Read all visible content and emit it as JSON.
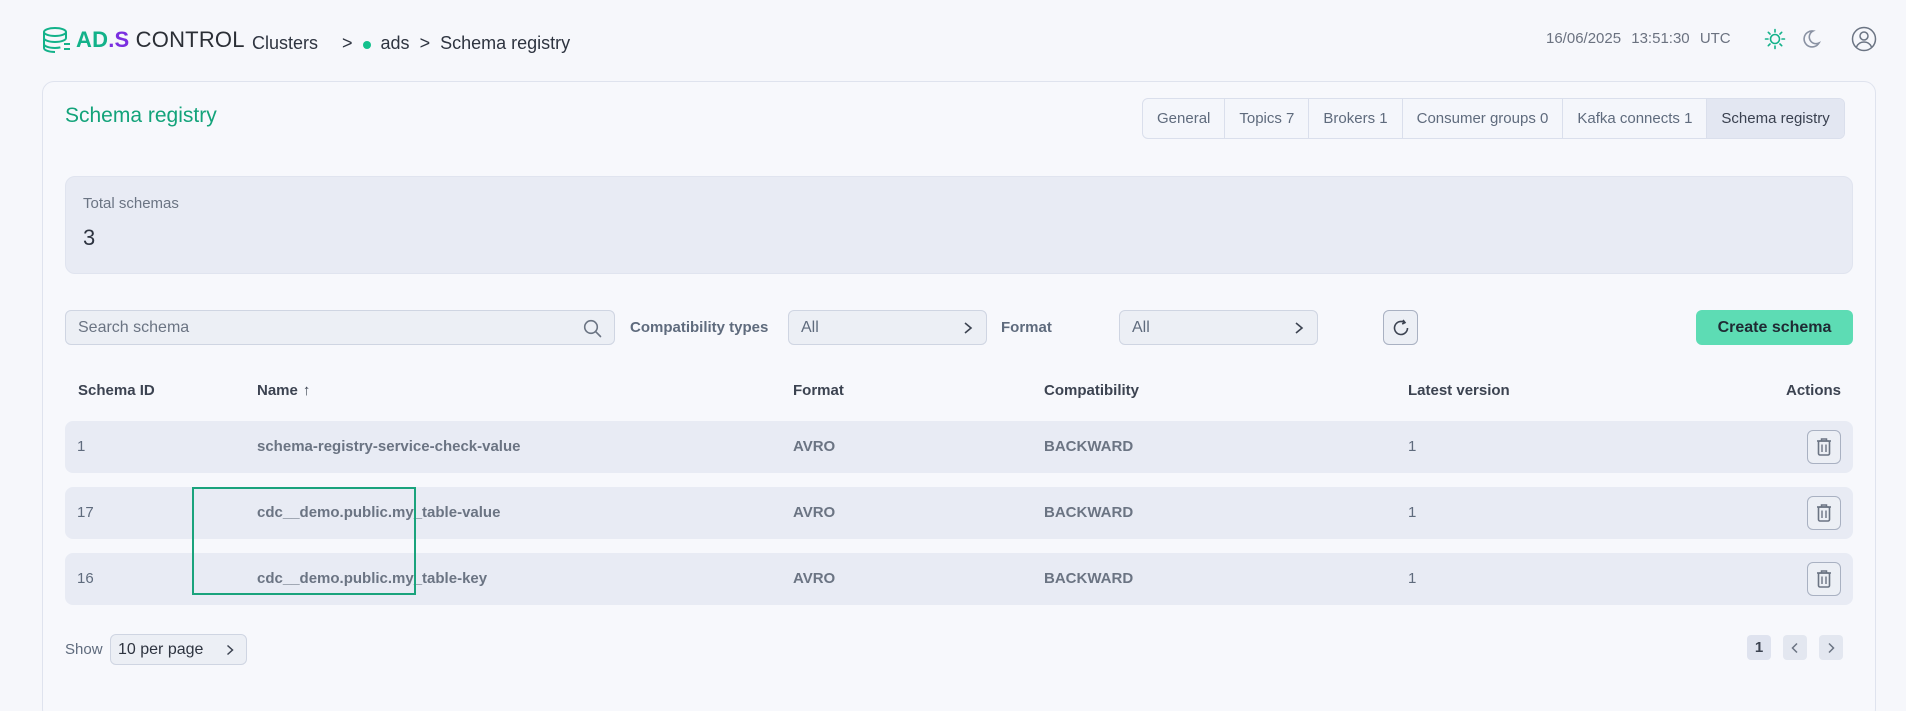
{
  "logo": {
    "brand_ads": "AD",
    "brand_dot": ".",
    "brand_s": "S",
    "brand_control": " CONTROL"
  },
  "breadcrumb": {
    "clusters": "Clusters",
    "sep1": ">",
    "cluster_name": "ads",
    "sep2": ">",
    "current": "Schema registry"
  },
  "header": {
    "date": "16/06/2025",
    "time": "13:51:30",
    "timezone": "UTC"
  },
  "page": {
    "title": "Schema registry"
  },
  "tabs": [
    {
      "label": "General"
    },
    {
      "label": "Topics 7"
    },
    {
      "label": "Brokers 1"
    },
    {
      "label": "Consumer groups 0"
    },
    {
      "label": "Kafka connects 1"
    },
    {
      "label": "Schema registry",
      "active": true
    }
  ],
  "summary": {
    "label": "Total schemas",
    "value": "3"
  },
  "filters": {
    "search_placeholder": "Search schema",
    "compat_label": "Compatibility types",
    "compat_value": "All",
    "format_label": "Format",
    "format_value": "All",
    "create_label": "Create schema"
  },
  "table": {
    "columns": {
      "id": "Schema ID",
      "name": "Name",
      "name_sort": "↑",
      "format": "Format",
      "compat": "Compatibility",
      "latest": "Latest version",
      "actions": "Actions"
    },
    "rows": [
      {
        "id": "1",
        "name": "schema-registry-service-check-value",
        "format": "AVRO",
        "compat": "BACKWARD",
        "latest": "1"
      },
      {
        "id": "17",
        "name": "cdc__demo.public.my_table-value",
        "format": "AVRO",
        "compat": "BACKWARD",
        "latest": "1"
      },
      {
        "id": "16",
        "name": "cdc__demo.public.my_table-key",
        "format": "AVRO",
        "compat": "BACKWARD",
        "latest": "1"
      }
    ]
  },
  "pagination": {
    "show_label": "Show",
    "per_page": "10 per page",
    "current_page": "1"
  },
  "colors": {
    "accent": "#13a37a",
    "create_button": "#5ddcb4",
    "status_ok": "#13c18d",
    "brand_purple": "#7b2fe0"
  }
}
